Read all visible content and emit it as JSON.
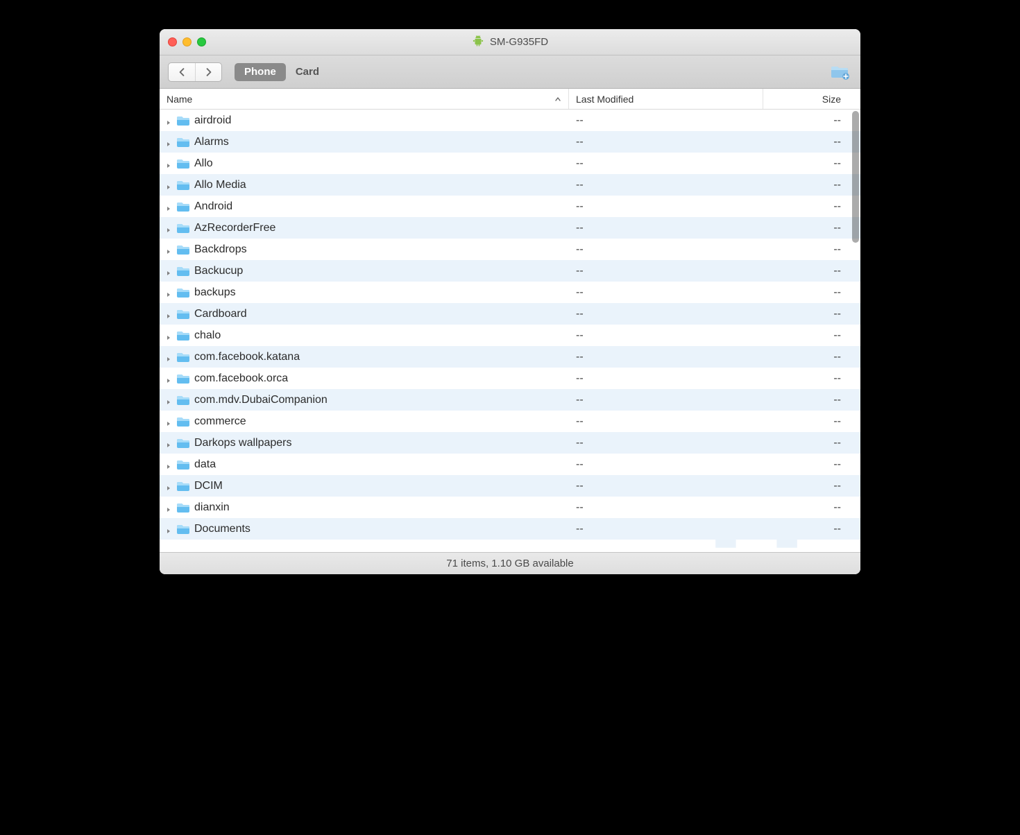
{
  "window": {
    "title": "SM-G935FD"
  },
  "toolbar": {
    "tabs": {
      "phone": "Phone",
      "card": "Card"
    },
    "active_tab": "phone"
  },
  "columns": {
    "name": "Name",
    "modified": "Last Modified",
    "size": "Size"
  },
  "items": [
    {
      "name": "airdroid",
      "modified": "--",
      "size": "--"
    },
    {
      "name": "Alarms",
      "modified": "--",
      "size": "--"
    },
    {
      "name": "Allo",
      "modified": "--",
      "size": "--"
    },
    {
      "name": "Allo Media",
      "modified": "--",
      "size": "--"
    },
    {
      "name": "Android",
      "modified": "--",
      "size": "--"
    },
    {
      "name": "AzRecorderFree",
      "modified": "--",
      "size": "--"
    },
    {
      "name": "Backdrops",
      "modified": "--",
      "size": "--"
    },
    {
      "name": "Backucup",
      "modified": "--",
      "size": "--"
    },
    {
      "name": "backups",
      "modified": "--",
      "size": "--"
    },
    {
      "name": "Cardboard",
      "modified": "--",
      "size": "--"
    },
    {
      "name": "chalo",
      "modified": "--",
      "size": "--"
    },
    {
      "name": "com.facebook.katana",
      "modified": "--",
      "size": "--"
    },
    {
      "name": "com.facebook.orca",
      "modified": "--",
      "size": "--"
    },
    {
      "name": "com.mdv.DubaiCompanion",
      "modified": "--",
      "size": "--"
    },
    {
      "name": "commerce",
      "modified": "--",
      "size": "--"
    },
    {
      "name": "Darkops wallpapers",
      "modified": "--",
      "size": "--"
    },
    {
      "name": "data",
      "modified": "--",
      "size": "--"
    },
    {
      "name": "DCIM",
      "modified": "--",
      "size": "--"
    },
    {
      "name": "dianxin",
      "modified": "--",
      "size": "--"
    },
    {
      "name": "Documents",
      "modified": "--",
      "size": "--"
    }
  ],
  "status": "71 items, 1.10 GB available"
}
